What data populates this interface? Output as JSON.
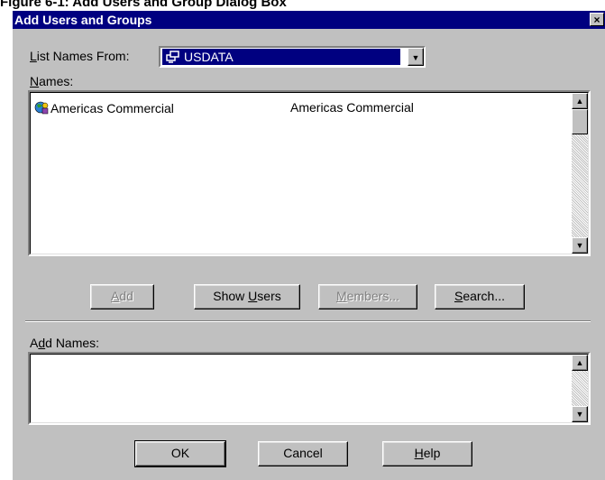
{
  "caption": "Figure 6-1: Add Users and Group Dialog Box",
  "dialog": {
    "title": "Add Users and Groups",
    "close_glyph": "×"
  },
  "list_names_from": {
    "label_prefix": "",
    "label_accel": "L",
    "label_rest": "ist Names From:",
    "selected_value": "USDATA"
  },
  "names": {
    "label_accel": "N",
    "label_rest": "ames:",
    "items": [
      {
        "name": "Americas Commercial",
        "description": "Americas Commercial"
      }
    ]
  },
  "buttons": {
    "add": {
      "accel": "A",
      "rest": "dd",
      "enabled": false
    },
    "show_users": {
      "pre": "Show ",
      "accel": "U",
      "rest": "sers",
      "enabled": true
    },
    "members": {
      "accel": "M",
      "rest": "embers...",
      "enabled": false
    },
    "search": {
      "accel": "S",
      "rest": "earch...",
      "enabled": true
    }
  },
  "add_names": {
    "label_pre": "A",
    "label_accel": "d",
    "label_rest": "d Names:",
    "value": ""
  },
  "footer": {
    "ok": "OK",
    "cancel": "Cancel",
    "help_accel": "H",
    "help_rest": "elp"
  },
  "icons": {
    "domain": "domain-computer-icon",
    "group": "group-globe-icon",
    "dropdown": "chevron-down-icon"
  },
  "colors": {
    "titlebar": "#000080",
    "face": "#c0c0c0",
    "selection": "#000080"
  }
}
